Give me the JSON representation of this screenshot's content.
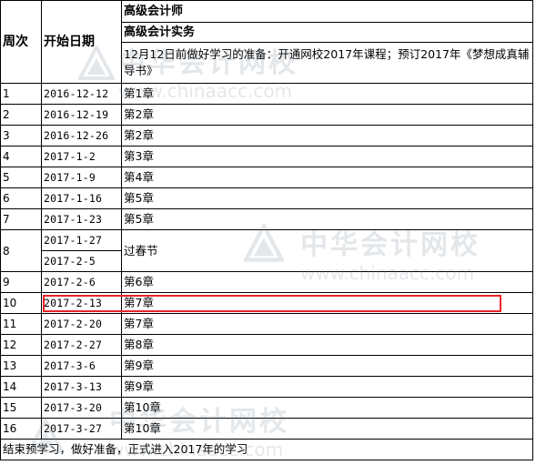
{
  "header": {
    "week_label": "周次",
    "date_label": "开始日期",
    "title1": "高级会计师",
    "title2": "高级会计实务",
    "prep_note": "12月12日前做好学习的准备：开通网校2017年课程；预订2017年《梦想成真辅导书》"
  },
  "rows": [
    {
      "week": "1",
      "date": "2016-12-12",
      "chapter": "第1章"
    },
    {
      "week": "2",
      "date": "2016-12-19",
      "chapter": "第2章"
    },
    {
      "week": "3",
      "date": "2016-12-26",
      "chapter": "第2章"
    },
    {
      "week": "4",
      "date": "2017-1-2",
      "chapter": "第3章"
    },
    {
      "week": "5",
      "date": "2017-1-9",
      "chapter": "第4章"
    },
    {
      "week": "6",
      "date": "2017-1-16",
      "chapter": "第5章"
    },
    {
      "week": "7",
      "date": "2017-1-23",
      "chapter": "第5章"
    },
    {
      "week": "8",
      "date": "2017-1-27",
      "date2": "2017-2-5",
      "chapter": "过春节"
    },
    {
      "week": "9",
      "date": "2017-2-6",
      "chapter": "第6章"
    },
    {
      "week": "10",
      "date": "2017-2-13",
      "chapter": "第7章"
    },
    {
      "week": "11",
      "date": "2017-2-20",
      "chapter": "第7章"
    },
    {
      "week": "12",
      "date": "2017-2-27",
      "chapter": "第8章"
    },
    {
      "week": "13",
      "date": "2017-3-6",
      "chapter": "第9章"
    },
    {
      "week": "14",
      "date": "2017-3-13",
      "chapter": "第9章"
    },
    {
      "week": "15",
      "date": "2017-3-20",
      "chapter": "第10章"
    },
    {
      "week": "16",
      "date": "2017-3-27",
      "chapter": "第10章"
    }
  ],
  "footer": "结束预学习，做好准备，正式进入2017年的学习",
  "watermark": {
    "name": "中华会计网校",
    "url": "www.chinaacc.com"
  },
  "colors": {
    "highlight": "#e8242a",
    "border": "#000000",
    "watermark": "#6f7f8f"
  },
  "icons": [
    "chinaacc-logo-icon"
  ]
}
